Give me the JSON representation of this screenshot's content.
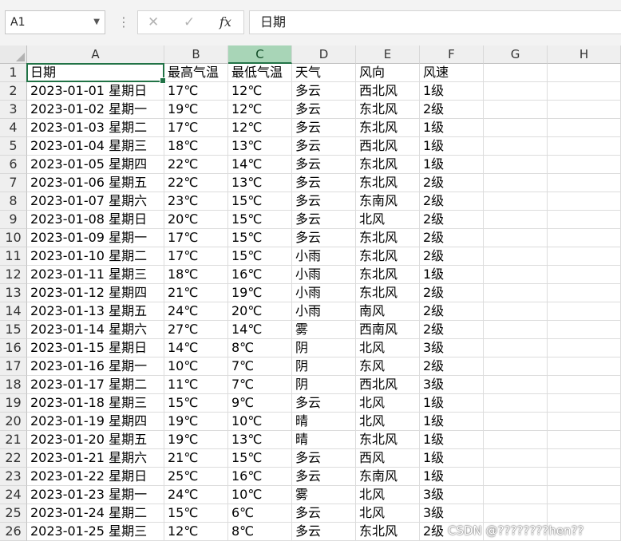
{
  "formula_bar": {
    "name_box": "A1",
    "cancel_icon": "✕",
    "enter_icon": "✓",
    "fx_label": "fx",
    "formula_value": "日期"
  },
  "sheet": {
    "selected_cell": "A1",
    "columns": [
      "A",
      "B",
      "C",
      "D",
      "E",
      "F",
      "G",
      "H"
    ],
    "rows": [
      [
        "日期",
        "最高气温",
        "最低气温",
        "天气",
        "风向",
        "风速"
      ],
      [
        "2023-01-01 星期日",
        "17℃",
        "12℃",
        "多云",
        "西北风",
        "1级"
      ],
      [
        "2023-01-02 星期一",
        "19℃",
        "12℃",
        "多云",
        "东北风",
        "2级"
      ],
      [
        "2023-01-03 星期二",
        "17℃",
        "12℃",
        "多云",
        "东北风",
        "1级"
      ],
      [
        "2023-01-04 星期三",
        "18℃",
        "13℃",
        "多云",
        "西北风",
        "1级"
      ],
      [
        "2023-01-05 星期四",
        "22℃",
        "14℃",
        "多云",
        "东北风",
        "1级"
      ],
      [
        "2023-01-06 星期五",
        "22℃",
        "13℃",
        "多云",
        "东北风",
        "2级"
      ],
      [
        "2023-01-07 星期六",
        "23℃",
        "15℃",
        "多云",
        "东南风",
        "2级"
      ],
      [
        "2023-01-08 星期日",
        "20℃",
        "15℃",
        "多云",
        "北风",
        "2级"
      ],
      [
        "2023-01-09 星期一",
        "17℃",
        "15℃",
        "多云",
        "东北风",
        "2级"
      ],
      [
        "2023-01-10 星期二",
        "17℃",
        "15℃",
        "小雨",
        "东北风",
        "2级"
      ],
      [
        "2023-01-11 星期三",
        "18℃",
        "16℃",
        "小雨",
        "东北风",
        "1级"
      ],
      [
        "2023-01-12 星期四",
        "21℃",
        "19℃",
        "小雨",
        "东北风",
        "2级"
      ],
      [
        "2023-01-13 星期五",
        "24℃",
        "20℃",
        "小雨",
        "南风",
        "2级"
      ],
      [
        "2023-01-14 星期六",
        "27℃",
        "14℃",
        "雾",
        "西南风",
        "2级"
      ],
      [
        "2023-01-15 星期日",
        "14℃",
        "8℃",
        "阴",
        "北风",
        "3级"
      ],
      [
        "2023-01-16 星期一",
        "10℃",
        "7℃",
        "阴",
        "东风",
        "2级"
      ],
      [
        "2023-01-17 星期二",
        "11℃",
        "7℃",
        "阴",
        "西北风",
        "3级"
      ],
      [
        "2023-01-18 星期三",
        "15℃",
        "9℃",
        "多云",
        "北风",
        "1级"
      ],
      [
        "2023-01-19 星期四",
        "19℃",
        "10℃",
        "晴",
        "北风",
        "1级"
      ],
      [
        "2023-01-20 星期五",
        "19℃",
        "13℃",
        "晴",
        "东北风",
        "1级"
      ],
      [
        "2023-01-21 星期六",
        "21℃",
        "15℃",
        "多云",
        "西风",
        "1级"
      ],
      [
        "2023-01-22 星期日",
        "25℃",
        "16℃",
        "多云",
        "东南风",
        "1级"
      ],
      [
        "2023-01-23 星期一",
        "24℃",
        "10℃",
        "雾",
        "北风",
        "3级"
      ],
      [
        "2023-01-24 星期二",
        "15℃",
        "6℃",
        "多云",
        "北风",
        "3级"
      ],
      [
        "2023-01-25 星期三",
        "12℃",
        "8℃",
        "多云",
        "东北风",
        "2级"
      ]
    ]
  },
  "watermark": "CSDN @????????hen??",
  "colors": {
    "accent": "#217346",
    "header_selected": "#a8d5b7"
  }
}
